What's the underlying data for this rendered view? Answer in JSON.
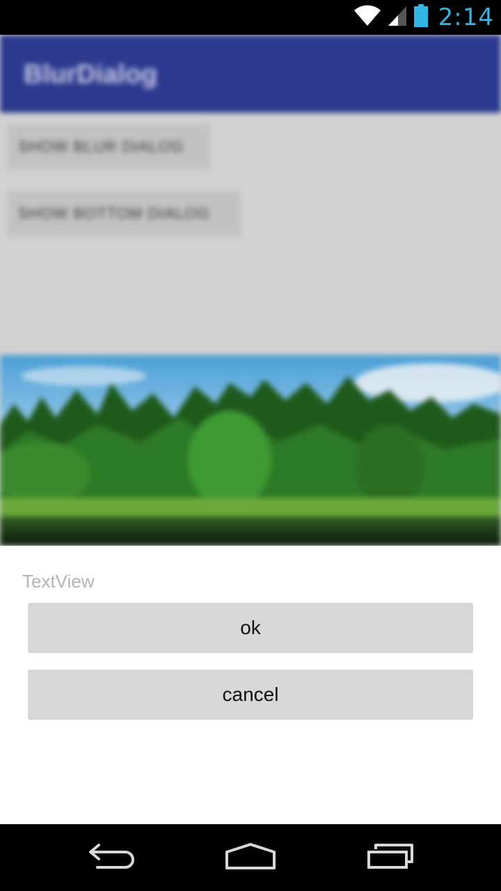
{
  "status_bar": {
    "time": "2:14",
    "icons": [
      "wifi-icon",
      "signal-icon",
      "battery-icon"
    ],
    "time_color": "#33b5e5"
  },
  "background_app": {
    "title": "BlurDialog",
    "buttons": [
      {
        "label": "SHOW BLUR DIALOG"
      },
      {
        "label": "SHOW BOTTOM DIALOG"
      }
    ],
    "toolbar_color": "#2c3a8f",
    "image": "landscape-photo"
  },
  "dialog": {
    "text": "TextView",
    "ok_label": "ok",
    "cancel_label": "cancel"
  },
  "nav_bar": {
    "icons": [
      "back-icon",
      "home-icon",
      "recents-icon"
    ]
  }
}
